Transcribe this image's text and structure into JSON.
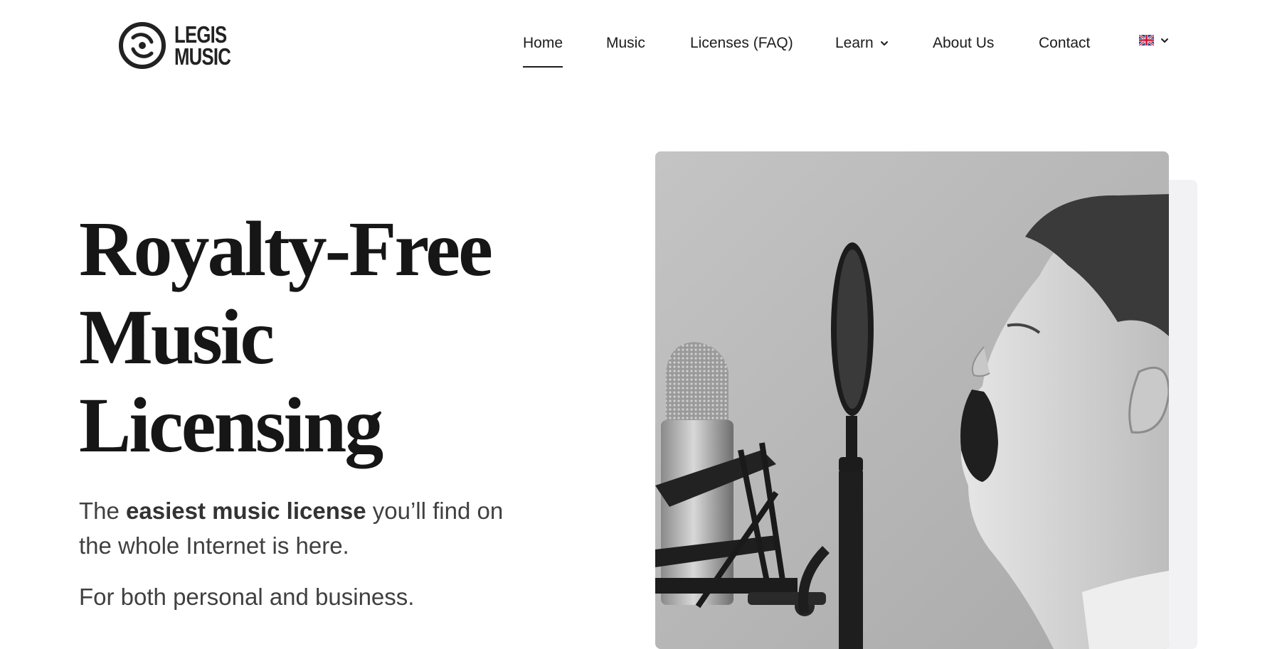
{
  "brand": {
    "logo_line1": "LEGIS",
    "logo_line2": "MUSIC",
    "logo_icon": "vinyl-disc-icon"
  },
  "nav": {
    "items": [
      {
        "label": "Home",
        "active": true
      },
      {
        "label": "Music"
      },
      {
        "label": "Licenses (FAQ)"
      },
      {
        "label": "Learn",
        "has_dropdown": true
      },
      {
        "label": "About Us"
      },
      {
        "label": "Contact"
      }
    ],
    "language_icon": "uk-flag-icon"
  },
  "hero": {
    "title_line1": "Royalty-Free",
    "title_line2": "Music",
    "title_line3": "Licensing",
    "lead_before": "The ",
    "lead_bold": "easiest music license",
    "lead_after": " you’ll find on the whole Internet is here.",
    "sub": "For both personal and business.",
    "image_label": "boy-singing-into-microphone-photo"
  },
  "colors": {
    "text": "#1a1a1a",
    "body_text": "#404040",
    "background": "#ffffff",
    "image_backdrop": "#f2f2f4"
  }
}
